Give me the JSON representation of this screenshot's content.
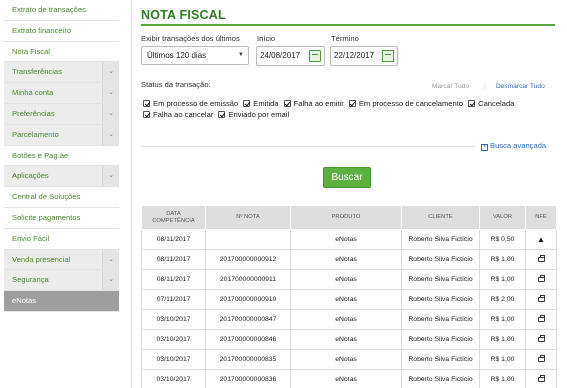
{
  "sidebar": {
    "items": [
      {
        "label": "Extrato de transações",
        "has_chevron": false,
        "style": "white"
      },
      {
        "label": "Extrato financeiro",
        "has_chevron": false,
        "style": "white"
      },
      {
        "label": "Nota Fiscal",
        "has_chevron": false,
        "style": "white"
      },
      {
        "label": "Transferências",
        "has_chevron": true,
        "style": "gray"
      },
      {
        "label": "Minha conta",
        "has_chevron": true,
        "style": "gray"
      },
      {
        "label": "Preferências",
        "has_chevron": true,
        "style": "gray"
      },
      {
        "label": "Parcelamento",
        "has_chevron": true,
        "style": "gray"
      },
      {
        "label": "Botões e Pag.ae",
        "has_chevron": false,
        "style": "white"
      },
      {
        "label": "Aplicações",
        "has_chevron": true,
        "style": "gray"
      },
      {
        "label": "Central de Soluções",
        "has_chevron": false,
        "style": "white"
      },
      {
        "label": "Solicite pagamentos",
        "has_chevron": false,
        "style": "white"
      },
      {
        "label": "Envio Fácil",
        "has_chevron": false,
        "style": "white"
      },
      {
        "label": "Venda presencial",
        "has_chevron": true,
        "style": "gray"
      },
      {
        "label": "Segurança",
        "has_chevron": true,
        "style": "gray"
      },
      {
        "label": "eNotas",
        "has_chevron": false,
        "style": "active"
      }
    ]
  },
  "page": {
    "title": "NOTA FISCAL"
  },
  "filters": {
    "period_label": "Exibir transações dos últimos",
    "period_value": "Últimos 120 dias",
    "start_label": "Início",
    "start_value": "24/08/2017",
    "end_label": "Término",
    "end_value": "22/12/2017",
    "status_label": "Status da transação:",
    "mark_all": "Marcar Tudo",
    "unmark_all": "Desmarcar Tudo",
    "statuses": [
      "Em processo de emissão",
      "Emitida",
      "Falha ao emitir",
      "Em processo de cancelamento",
      "Cancelada",
      "Falha ao cancelar",
      "Enviado por email"
    ],
    "advanced_search": "Busca avançada",
    "search_button": "Buscar"
  },
  "table": {
    "headers": [
      "DATA\nCOMPETÊNCIA",
      "Nº NOTA",
      "PRODUTO",
      "CLIENTE",
      "VALOR",
      "NFE"
    ],
    "rows": [
      {
        "date": "08/11/2017",
        "number": "",
        "product": "eNotas",
        "client": "Roberto Silva Fictício",
        "value": "R$ 0,50",
        "nfe": "warning-icon"
      },
      {
        "date": "08/11/2017",
        "number": "201700000000912",
        "product": "eNotas",
        "client": "Roberto Silva Fictício",
        "value": "R$ 1,00",
        "nfe": "print-icon"
      },
      {
        "date": "08/11/2017",
        "number": "201700000000911",
        "product": "eNotas",
        "client": "Roberto Silva Fictício",
        "value": "R$ 1,00",
        "nfe": "print-icon"
      },
      {
        "date": "07/11/2017",
        "number": "201700000000910",
        "product": "eNotas",
        "client": "Roberto Silva Fictício",
        "value": "R$ 2,00",
        "nfe": "print-icon"
      },
      {
        "date": "03/10/2017",
        "number": "201700000000847",
        "product": "eNotas",
        "client": "Roberto Silva Fictício",
        "value": "R$ 1,00",
        "nfe": "print-icon"
      },
      {
        "date": "03/10/2017",
        "number": "201700000000846",
        "product": "eNotas",
        "client": "Roberto Silva Fictício",
        "value": "R$ 1,00",
        "nfe": "print-icon"
      },
      {
        "date": "03/10/2017",
        "number": "201700000000835",
        "product": "eNotas",
        "client": "Roberto Silva Fictício",
        "value": "R$ 1,00",
        "nfe": "print-icon"
      },
      {
        "date": "03/10/2017",
        "number": "201700000000836",
        "product": "eNotas",
        "client": "Roberto Silva Fictício",
        "value": "R$ 1,00",
        "nfe": "print-icon"
      }
    ]
  }
}
